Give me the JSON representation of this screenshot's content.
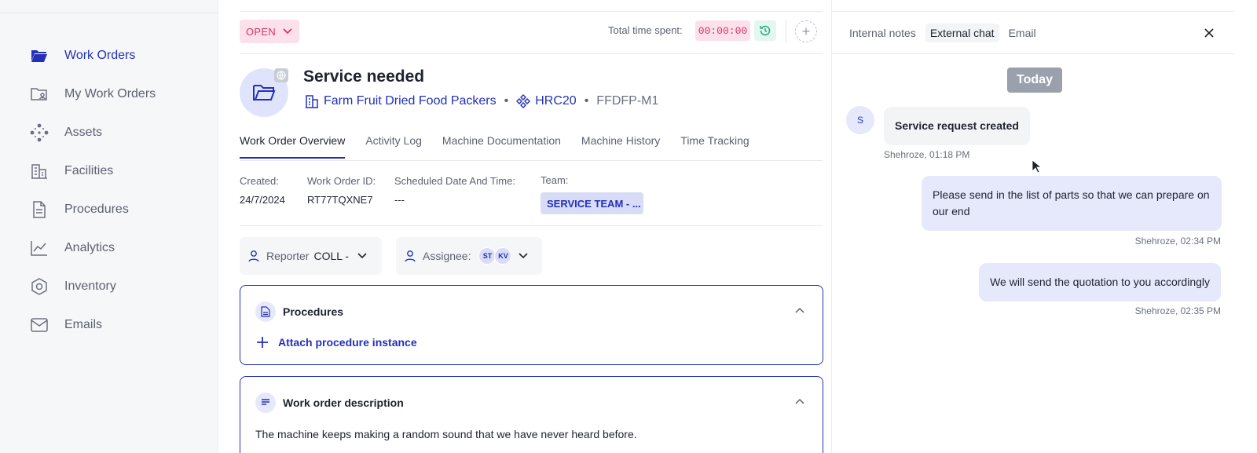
{
  "sidebar": {
    "items": [
      {
        "label": "Work Orders",
        "icon": "folder-open-icon",
        "active": true
      },
      {
        "label": "My Work Orders",
        "icon": "folder-user-icon",
        "active": false
      },
      {
        "label": "Assets",
        "icon": "assets-nodes-icon",
        "active": false
      },
      {
        "label": "Facilities",
        "icon": "building-icon",
        "active": false
      },
      {
        "label": "Procedures",
        "icon": "document-icon",
        "active": false
      },
      {
        "label": "Analytics",
        "icon": "chart-line-icon",
        "active": false
      },
      {
        "label": "Inventory",
        "icon": "hexagon-icon",
        "active": false
      },
      {
        "label": "Emails",
        "icon": "mail-icon",
        "active": false
      }
    ]
  },
  "header": {
    "status": "OPEN",
    "time_label": "Total time spent:",
    "time_value": "00:00:00"
  },
  "work_order": {
    "title": "Service needed",
    "facility": "Farm Fruit Dried Food Packers",
    "asset": "HRC20",
    "code": "FFDFP-M1"
  },
  "tabs": [
    {
      "label": "Work Order Overview",
      "active": true
    },
    {
      "label": "Activity Log",
      "active": false
    },
    {
      "label": "Machine Documentation",
      "active": false
    },
    {
      "label": "Machine History",
      "active": false
    },
    {
      "label": "Time Tracking",
      "active": false
    }
  ],
  "details": {
    "created_label": "Created:",
    "created_value": "24/7/2024",
    "id_label": "Work Order ID:",
    "id_value": "RT77TQXNE7",
    "schedule_label": "Scheduled Date And Time:",
    "schedule_value": "---",
    "team_label": "Team:",
    "team_value": "SERVICE TEAM - ..."
  },
  "people": {
    "reporter_label": "Reporter",
    "reporter_value": "COLL -",
    "assignee_label": "Assignee:",
    "assignees": [
      "ST",
      "KV"
    ]
  },
  "procedures_card": {
    "title": "Procedures",
    "attach_label": "Attach procedure instance"
  },
  "description_card": {
    "title": "Work order description",
    "text": "The machine keeps making a random sound that we have never heard before."
  },
  "panel": {
    "tabs": [
      {
        "label": "Internal notes",
        "active": false
      },
      {
        "label": "External chat",
        "active": true
      },
      {
        "label": "Email",
        "active": false
      }
    ],
    "date_separator": "Today",
    "sender_initial": "S",
    "messages": [
      {
        "text": "Service request created",
        "stamp": "Shehroze, 01:18 PM"
      },
      {
        "text": "Please send in the list of parts so that we can prepare on our end",
        "stamp": "Shehroze, 02:34 PM"
      },
      {
        "text": "We will send the quotation to you accordingly",
        "stamp": "Shehroze, 02:35 PM"
      }
    ]
  }
}
